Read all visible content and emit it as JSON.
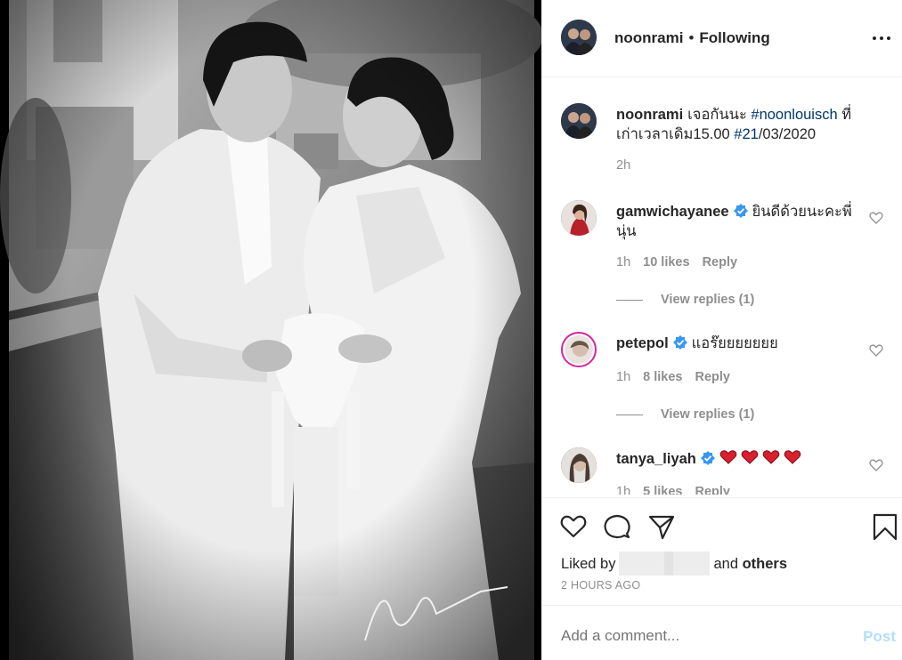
{
  "post": {
    "username": "noonrami",
    "separator": "•",
    "follow_status": "Following",
    "caption_text": "เจอกันนะ",
    "caption_tag": "#noonlouisch",
    "caption_text2": "ที่เก่าเวลาเดิม15.00",
    "caption_tag2": "#21",
    "caption_date": "/03/2020",
    "caption_time": "2h"
  },
  "comments": [
    {
      "username": "gamwichayanee",
      "text": "ยินดีด้วยนะคะพี่นุ่น",
      "time": "1h",
      "likes": "10 likes",
      "reply": "Reply",
      "view_replies": "View replies (1)"
    },
    {
      "username": "petepol",
      "text": "แอร๊ยยยยยยย",
      "time": "1h",
      "likes": "8 likes",
      "reply": "Reply",
      "view_replies": "View replies (1)"
    },
    {
      "username": "tanya_liyah",
      "text": "",
      "time": "1h",
      "likes": "5 likes",
      "reply": "Reply"
    }
  ],
  "actions": {
    "liked_by_prefix": "Liked by",
    "liked_by_and": "and",
    "liked_by_others": "others",
    "timestamp": "2 HOURS AGO"
  },
  "add_comment": {
    "placeholder": "Add a comment...",
    "post_label": "Post"
  },
  "colors": {
    "link": "#00376b",
    "verified": "#3897f0",
    "muted": "#8e8e8e",
    "post_disabled": "#b2dffc",
    "heart_red": "#ed4956"
  },
  "icons": [
    "more-options-icon",
    "verified-badge-icon",
    "heart-icon",
    "comment-icon",
    "share-icon",
    "save-icon"
  ]
}
